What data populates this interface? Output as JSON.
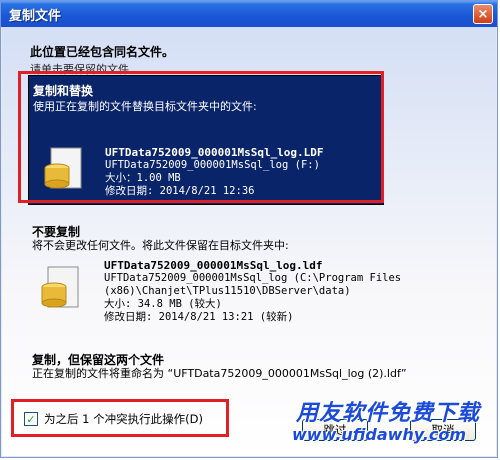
{
  "window": {
    "title": "复制文件",
    "close_symbol": "×"
  },
  "header": {
    "heading": "此位置已经包含同名文件。",
    "subheading": "请单击要保留的文件"
  },
  "option_replace": {
    "title": "复制和替换",
    "description": "使用正在复制的文件替换目标文件夹中的文件:",
    "file": {
      "name": "UFTData752009_000001MsSql_log.LDF",
      "path": "UFTData752009_000001MsSql_log (F:)",
      "size": "大小：1.00 MB",
      "modified": "修改日期: 2014/8/21 12:36"
    }
  },
  "option_skip": {
    "title": "不要复制",
    "description": "将不会更改任何文件。将此文件保留在目标文件夹中:",
    "file": {
      "name": "UFTData752009_000001MsSql_log.ldf",
      "path_line1": "UFTData752009_000001MsSql_log (C:\\Program Files",
      "path_line2": "(x86)\\Chanjet\\TPlus11510\\DBServer\\data)",
      "size": "大小: 34.8 MB (较大)",
      "modified": "修改日期: 2014/8/21 13:21 (较新)"
    }
  },
  "option_keep_both": {
    "title": "复制，但保留这两个文件",
    "description": "正在复制的文件将重命名为 “UFTData752009_000001MsSql_log (2).ldf”"
  },
  "footer": {
    "checkbox_label": "为之后 1 个冲突执行此操作(D)",
    "checkbox_checked": true,
    "skip_button_label": "跳过",
    "cancel_button_label": "取消",
    "watermark_cn": "用友软件免费下载",
    "watermark_url": "www.ufidawhy.com"
  },
  "colors": {
    "selection": "#0a246a",
    "highlight_border": "#e01f26",
    "title_bar": "#1b58d6"
  }
}
